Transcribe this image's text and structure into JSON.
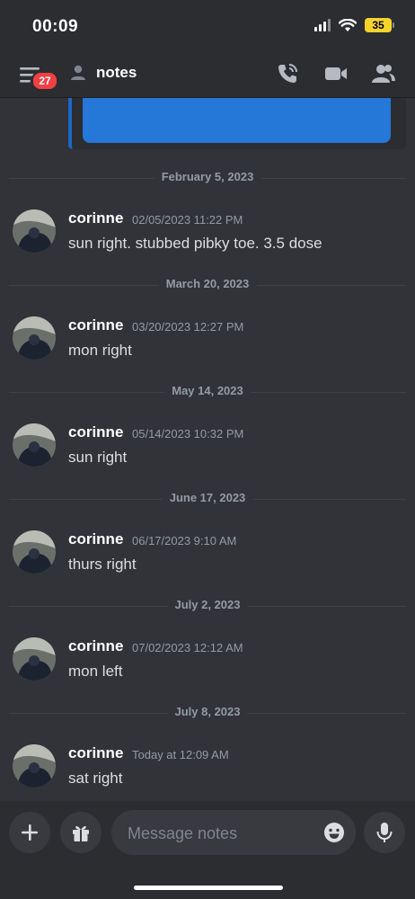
{
  "status_bar": {
    "time": "00:09",
    "battery": "35"
  },
  "header": {
    "unread_badge": "27",
    "channel_title": "notes"
  },
  "messages": [
    {
      "divider": "February 5, 2023",
      "author": "corinne",
      "timestamp": "02/05/2023 11:22 PM",
      "text": "sun right. stubbed pibky toe. 3.5 dose"
    },
    {
      "divider": "March 20, 2023",
      "author": "corinne",
      "timestamp": "03/20/2023 12:27 PM",
      "text": "mon right"
    },
    {
      "divider": "May 14, 2023",
      "author": "corinne",
      "timestamp": "05/14/2023 10:32 PM",
      "text": "sun right"
    },
    {
      "divider": "June 17, 2023",
      "author": "corinne",
      "timestamp": "06/17/2023 9:10 AM",
      "text": "thurs right"
    },
    {
      "divider": "July 2, 2023",
      "author": "corinne",
      "timestamp": "07/02/2023 12:12 AM",
      "text": "mon left"
    },
    {
      "divider": "July 8, 2023",
      "author": "corinne",
      "timestamp": "Today at 12:09 AM",
      "text": "sat right"
    }
  ],
  "composer": {
    "placeholder": "Message notes"
  },
  "icons": {
    "menu": "menu-icon",
    "channel": "person-icon",
    "call": "phone-call-icon",
    "video": "video-camera-icon",
    "members": "members-icon",
    "add": "plus-icon",
    "gift": "gift-icon",
    "emoji": "emoji-icon",
    "mic": "microphone-icon"
  },
  "colors": {
    "accent_badge": "#f23f43",
    "embed_blue": "#2577d8",
    "background": "#313338"
  }
}
